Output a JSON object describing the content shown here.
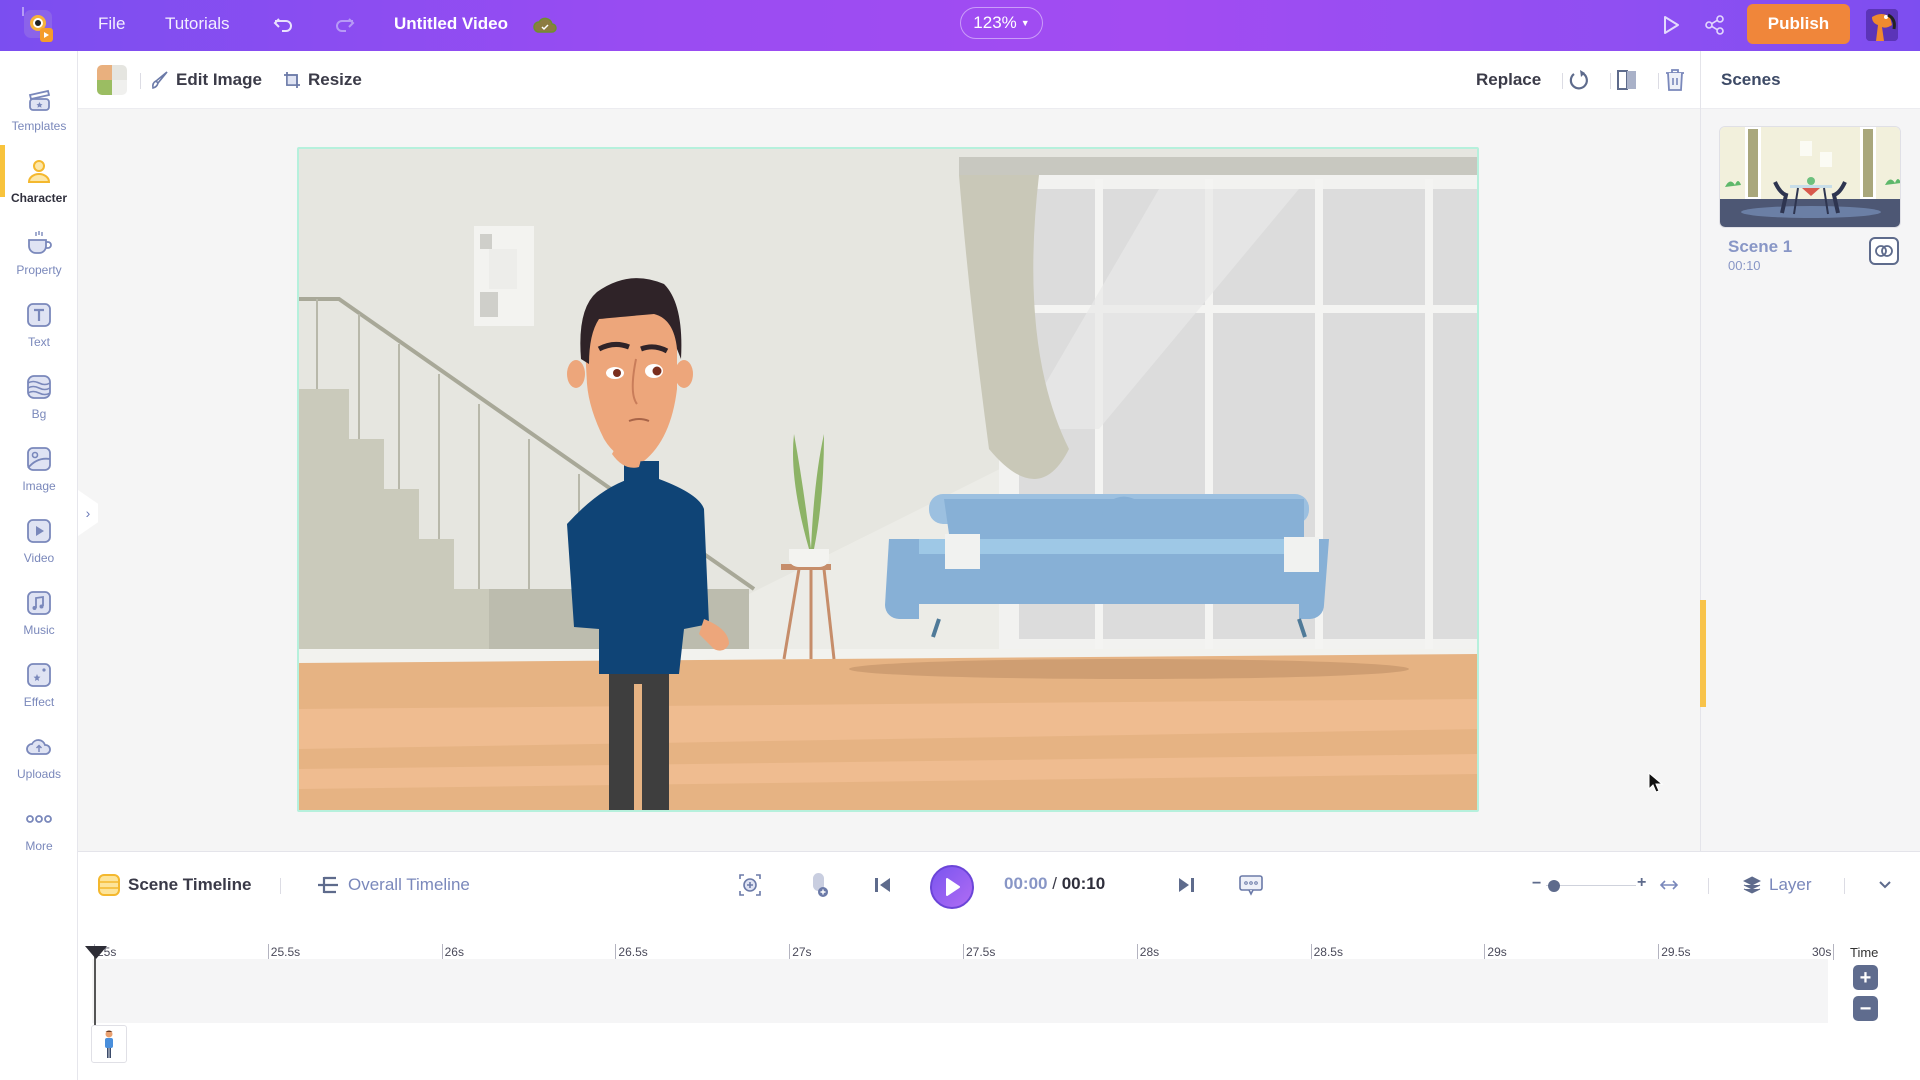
{
  "topbar": {
    "menu": [
      {
        "label": "File"
      },
      {
        "label": "Tutorials"
      }
    ],
    "undo_icon": "undo-icon",
    "redo_icon": "redo-icon",
    "project_title": "Untitled Video",
    "save_status_icon": "cloud-check-icon",
    "zoom_level": "123%",
    "preview_icon": "play-outline-icon",
    "share_icon": "share-icon",
    "publish_label": "Publish",
    "colors": {
      "accent": "#9a4cf2",
      "publish": "#f0863a"
    }
  },
  "sidebar": {
    "items": [
      {
        "label": "Templates",
        "icon": "templates-icon",
        "active": false
      },
      {
        "label": "Character",
        "icon": "character-icon",
        "active": true
      },
      {
        "label": "Property",
        "icon": "property-icon",
        "active": false
      },
      {
        "label": "Text",
        "icon": "text-icon",
        "active": false
      },
      {
        "label": "Bg",
        "icon": "background-icon",
        "active": false
      },
      {
        "label": "Image",
        "icon": "image-icon",
        "active": false
      },
      {
        "label": "Video",
        "icon": "video-icon",
        "active": false
      },
      {
        "label": "Music",
        "icon": "music-icon",
        "active": false
      },
      {
        "label": "Effect",
        "icon": "effect-icon",
        "active": false
      },
      {
        "label": "Uploads",
        "icon": "upload-cloud-icon",
        "active": false
      },
      {
        "label": "More",
        "icon": "more-dots-icon",
        "active": false
      }
    ],
    "active_color": "#f8c33c"
  },
  "toolbar": {
    "edit_image_label": "Edit Image",
    "resize_label": "Resize",
    "replace_label": "Replace",
    "rotate_icon": "rotate-icon",
    "flip_icon": "flip-icon",
    "delete_icon": "trash-icon"
  },
  "scenes": {
    "title": "Scenes",
    "items": [
      {
        "name": "Scene 1",
        "duration": "00:10"
      }
    ]
  },
  "timeline": {
    "tabs": [
      {
        "label": "Scene Timeline",
        "active": true
      },
      {
        "label": "Overall Timeline",
        "active": false
      }
    ],
    "current_time": "00:00",
    "separator": "/",
    "total_time": "00:10",
    "layer_label": "Layer",
    "ruler_ticks": [
      "25s",
      "25.5s",
      "26s",
      "26.5s",
      "27s",
      "27.5s",
      "28s",
      "28.5s",
      "29s",
      "29.5s",
      "30s"
    ],
    "time_label": "Time",
    "zoom_plus": "+",
    "zoom_minus": "−",
    "zoom_slider_value": 0.0
  }
}
